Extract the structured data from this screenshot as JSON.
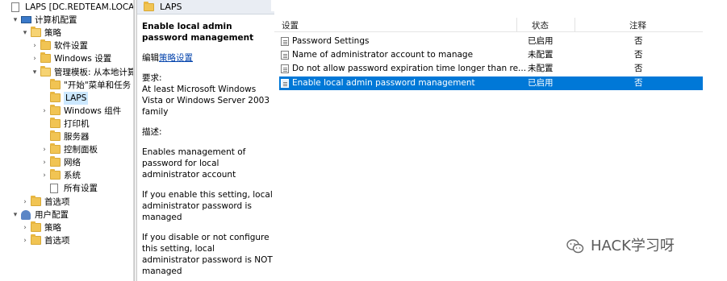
{
  "tree": {
    "items": [
      {
        "label": "LAPS [DC.REDTEAM.LOCAL] 策",
        "icon": "policy-doc-icon",
        "indent": 0,
        "expander": "",
        "selected": false
      },
      {
        "label": "计算机配置",
        "icon": "computer-icon",
        "indent": 1,
        "expander": "▾",
        "selected": false
      },
      {
        "label": "策略",
        "icon": "folder-icon",
        "indent": 2,
        "expander": "▾",
        "selected": false
      },
      {
        "label": "软件设置",
        "icon": "folder-icon",
        "indent": 3,
        "expander": "›",
        "selected": false
      },
      {
        "label": "Windows 设置",
        "icon": "folder-icon",
        "indent": 3,
        "expander": "›",
        "selected": false
      },
      {
        "label": "管理模板: 从本地计算",
        "icon": "folder-icon",
        "indent": 3,
        "expander": "▾",
        "selected": false
      },
      {
        "label": "\"开始\"菜单和任务",
        "icon": "folder-icon",
        "indent": 4,
        "expander": "",
        "selected": false
      },
      {
        "label": "LAPS",
        "icon": "folder-icon",
        "indent": 4,
        "expander": "",
        "selected": true
      },
      {
        "label": "Windows 组件",
        "icon": "folder-icon",
        "indent": 4,
        "expander": "›",
        "selected": false
      },
      {
        "label": "打印机",
        "icon": "folder-icon",
        "indent": 4,
        "expander": "",
        "selected": false
      },
      {
        "label": "服务器",
        "icon": "folder-icon",
        "indent": 4,
        "expander": "",
        "selected": false
      },
      {
        "label": "控制面板",
        "icon": "folder-icon",
        "indent": 4,
        "expander": "›",
        "selected": false
      },
      {
        "label": "网络",
        "icon": "folder-icon",
        "indent": 4,
        "expander": "›",
        "selected": false
      },
      {
        "label": "系统",
        "icon": "folder-icon",
        "indent": 4,
        "expander": "›",
        "selected": false
      },
      {
        "label": "所有设置",
        "icon": "settings-list-icon",
        "indent": 4,
        "expander": "",
        "selected": false
      },
      {
        "label": "首选项",
        "icon": "folder-icon",
        "indent": 2,
        "expander": "›",
        "selected": false
      },
      {
        "label": "用户配置",
        "icon": "user-icon",
        "indent": 1,
        "expander": "▾",
        "selected": false
      },
      {
        "label": "策略",
        "icon": "folder-icon",
        "indent": 2,
        "expander": "›",
        "selected": false
      },
      {
        "label": "首选项",
        "icon": "folder-icon",
        "indent": 2,
        "expander": "›",
        "selected": false
      }
    ]
  },
  "pane_header": {
    "title": "LAPS"
  },
  "description": {
    "title": "Enable local admin password management",
    "edit_prefix": "编辑",
    "edit_link": "策略设置",
    "requirements_label": "要求:",
    "requirements": "At least Microsoft Windows Vista or Windows Server 2003 family",
    "desc_label": "描述:",
    "paragraphs": [
      "Enables management of password for local administrator account",
      "If you enable this setting, local administrator password is managed",
      "If you disable or not configure this setting, local administrator password is NOT managed"
    ]
  },
  "list": {
    "columns": {
      "setting": "设置",
      "state": "状态",
      "comment": "注释"
    },
    "rows": [
      {
        "name": "Password Settings",
        "state": "已启用",
        "comment": "否",
        "selected": false
      },
      {
        "name": "Name of administrator account to manage",
        "state": "未配置",
        "comment": "否",
        "selected": false
      },
      {
        "name": "Do not allow password expiration time longer than re...",
        "state": "未配置",
        "comment": "否",
        "selected": false
      },
      {
        "name": "Enable local admin password management",
        "state": "已启用",
        "comment": "否",
        "selected": true
      }
    ]
  },
  "watermark": {
    "text": "HACK学习呀"
  },
  "colors": {
    "selection": "#0078d7",
    "tree_selection": "#cce8ff",
    "folder": "#f1c453",
    "link": "#0645ad"
  }
}
